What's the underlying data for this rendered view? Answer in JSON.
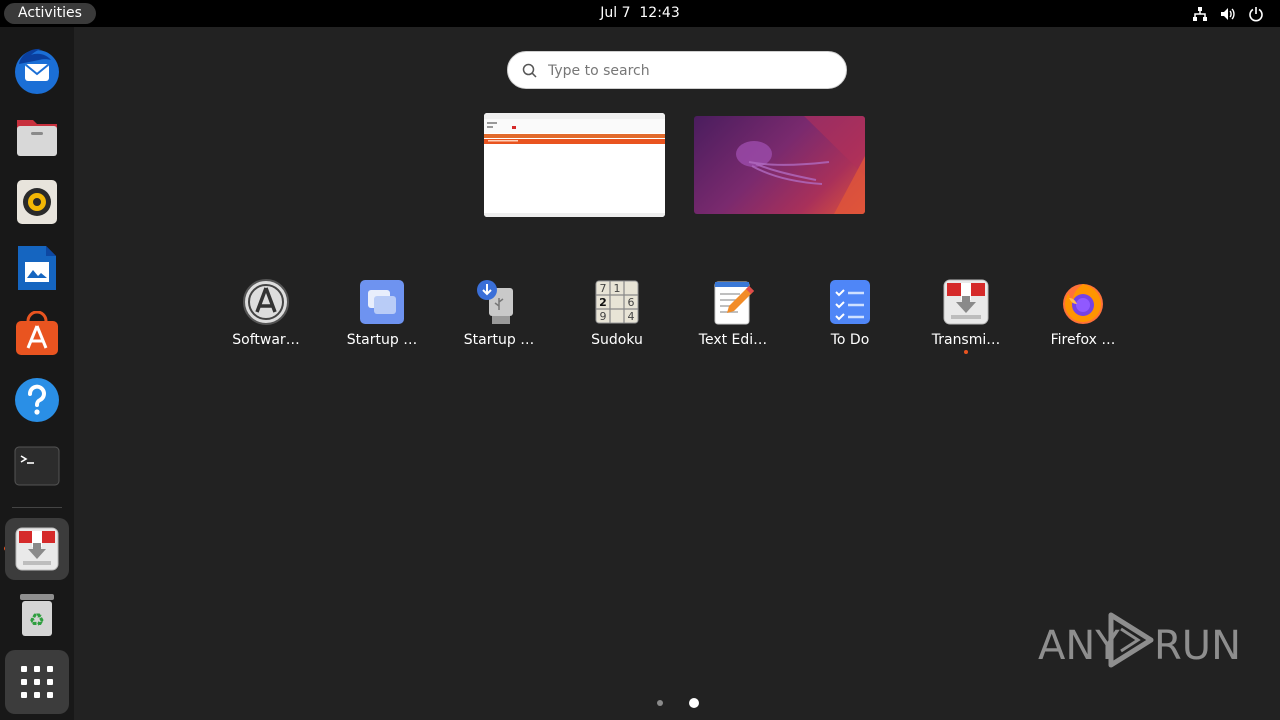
{
  "topbar": {
    "activities_label": "Activities",
    "date": "Jul 7",
    "time": "12:43",
    "tray_icons": [
      "network-icon",
      "volume-icon",
      "power-icon"
    ]
  },
  "dock": {
    "items": [
      {
        "name": "thunderbird",
        "icon": "thunderbird-icon",
        "running": false
      },
      {
        "name": "files",
        "icon": "files-icon",
        "running": false
      },
      {
        "name": "rhythmbox",
        "icon": "rhythmbox-icon",
        "running": false
      },
      {
        "name": "libreoffice-writer",
        "icon": "writer-icon",
        "running": false
      },
      {
        "name": "app-center",
        "icon": "app-center-icon",
        "running": false
      },
      {
        "name": "help",
        "icon": "help-icon",
        "running": false
      },
      {
        "name": "terminal",
        "icon": "terminal-icon",
        "running": false
      },
      {
        "name": "transmission",
        "icon": "transmission-icon",
        "running": true
      },
      {
        "name": "trash",
        "icon": "trash-icon",
        "running": false
      },
      {
        "name": "show-apps",
        "icon": "grid-icon",
        "running": false
      }
    ],
    "accent": "#e95420"
  },
  "search": {
    "placeholder": "Type to search"
  },
  "workspaces": [
    {
      "name": "workspace-1",
      "content": "window"
    },
    {
      "name": "workspace-2",
      "content": "wallpaper"
    }
  ],
  "apps": [
    {
      "label": "Softwar…",
      "icon": "software-properties-icon",
      "running": false
    },
    {
      "label": "Startup …",
      "icon": "startup-applications-icon",
      "running": false
    },
    {
      "label": "Startup …",
      "icon": "startup-disk-creator-icon",
      "running": false
    },
    {
      "label": "Sudoku",
      "icon": "sudoku-icon",
      "running": false
    },
    {
      "label": "Text Edi…",
      "icon": "text-editor-icon",
      "running": false
    },
    {
      "label": "To Do",
      "icon": "todo-icon",
      "running": false
    },
    {
      "label": "Transmi…",
      "icon": "transmission-icon",
      "running": true
    },
    {
      "label": "Firefox …",
      "icon": "firefox-icon",
      "running": false
    }
  ],
  "sudoku_digits": [
    "7",
    "1",
    "2",
    "6",
    "9",
    "4"
  ],
  "page_indicator": {
    "pages": 2,
    "current": 2
  },
  "watermark": {
    "text_left": "ANY",
    "text_right": "RUN"
  }
}
